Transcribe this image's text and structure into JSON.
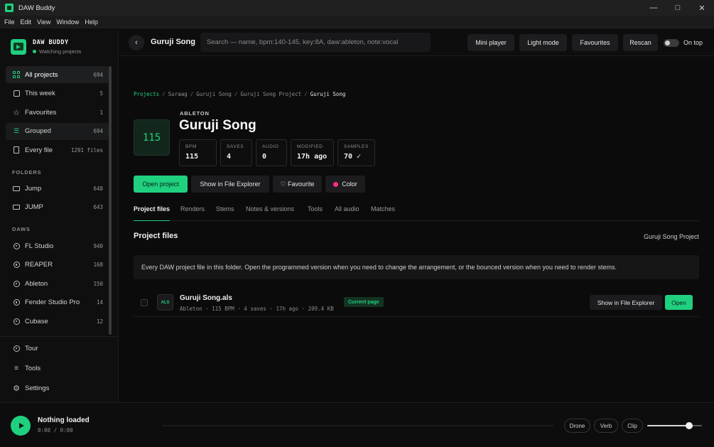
{
  "window": {
    "title": "DAW Buddy"
  },
  "menu": [
    "File",
    "Edit",
    "View",
    "Window",
    "Help"
  ],
  "brand": {
    "name": "DAW BUDDY",
    "status": "Watching projects"
  },
  "sidebar": {
    "library": [
      {
        "label": "All projects",
        "count": "694",
        "icon": "grid-icon"
      },
      {
        "label": "This week",
        "count": "5",
        "icon": "calendar-icon"
      },
      {
        "label": "Favourites",
        "count": "1",
        "icon": "star-icon"
      },
      {
        "label": "Grouped",
        "count": "694",
        "icon": "layers-icon"
      },
      {
        "label": "Every file",
        "count": "1291 files",
        "icon": "file-icon"
      }
    ],
    "folders_header": "FOLDERS",
    "folders": [
      {
        "label": "Jump",
        "count": "648"
      },
      {
        "label": "JUMP",
        "count": "643"
      }
    ],
    "daws_header": "DAWS",
    "daws": [
      {
        "label": "FL Studio",
        "count": "940"
      },
      {
        "label": "REAPER",
        "count": "168"
      },
      {
        "label": "Ableton",
        "count": "150"
      },
      {
        "label": "Fender Studio Pro",
        "count": "14"
      },
      {
        "label": "Cubase",
        "count": "12"
      }
    ],
    "footer": [
      {
        "label": "Tour"
      },
      {
        "label": "Tools"
      },
      {
        "label": "Settings"
      }
    ]
  },
  "topbar": {
    "title": "Guruji Song",
    "search_placeholder": "Search — name, bpm:140-145, key:8A, daw:ableton, note:vocal",
    "buttons": [
      "Mini player",
      "Light mode",
      "Favourites",
      "Rescan"
    ],
    "toggle_label": "On top"
  },
  "breadcrumb": [
    "Projects",
    "Suraag",
    "Guruji Song",
    "Guruji Song Project",
    "Guruji Song"
  ],
  "project": {
    "bpm_tile": "115",
    "daw": "ABLETON",
    "title": "Guruji Song",
    "stats": [
      {
        "key": "BPM",
        "value": "115"
      },
      {
        "key": "SAVES",
        "value": "4"
      },
      {
        "key": "AUDIO",
        "value": "0"
      },
      {
        "key": "MODIFIED",
        "value": "17h ago"
      },
      {
        "key": "SAMPLES",
        "value": "70 ✓"
      }
    ]
  },
  "actions": {
    "open": "Open project",
    "explorer": "Show in File Explorer",
    "favourite": "♡ Favourite",
    "color": "Color",
    "color_value": "#ff2d8a"
  },
  "tabs": [
    "Project files",
    "Renders",
    "Stems",
    "Notes & versions",
    "Tools",
    "All audio",
    "Matches"
  ],
  "files_section": {
    "title": "Project files",
    "right": "Guruji Song Project",
    "info": "Every DAW project file in this folder. Open the programmed version when you need to change the arrangement, or the bounced version when you need to render stems.",
    "rows": [
      {
        "badge": "ALS",
        "name": "Guruji Song.als",
        "meta": "Ableton · 115 BPM · 4 saves · 17h ago · 209.4 KB",
        "tag": "Current page",
        "explorer": "Show in File Explorer",
        "open": "Open"
      }
    ]
  },
  "player": {
    "title": "Nothing loaded",
    "time": "0:00 / 0:00",
    "pills": [
      "Drone",
      "Verb",
      "Clip"
    ],
    "volume": 0.76
  },
  "colors": {
    "accent": "#1fd07f",
    "bg": "#0b0b0c"
  }
}
